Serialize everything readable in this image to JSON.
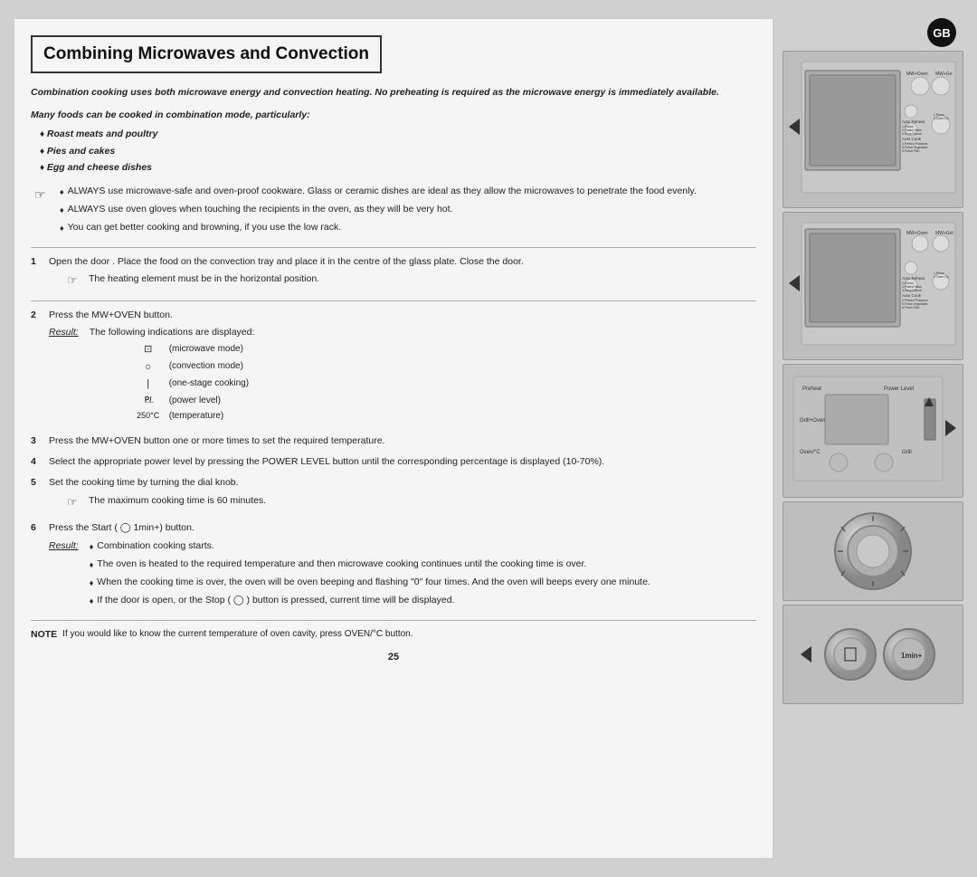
{
  "page": {
    "title": "Combining Microwaves and Convection",
    "page_number": "25",
    "gb_label": "GB"
  },
  "header": {
    "title": "Combining Microwaves and Convection"
  },
  "intro": {
    "text": "Combination cooking uses both microwave energy and convection heating. No preheating is required as the microwave energy is immediately available."
  },
  "foods_heading": "Many foods can be cooked in combination mode, particularly:",
  "food_bullets": [
    "Roast meats and poultry",
    "Pies and cakes",
    "Egg and cheese dishes"
  ],
  "notes": [
    "ALWAYS use microwave-safe and oven-proof cookware. Glass or ceramic dishes are ideal as they allow the microwaves to penetrate the food evenly.",
    "ALWAYS use oven gloves when touching the recipients in the oven, as they will be very hot.",
    "You can get better cooking and browning, if you use the low rack."
  ],
  "steps": [
    {
      "num": "1",
      "text": "Open the door . Place the food on the convection tray and place it in the centre of the glass plate. Close the door.",
      "note": "The heating element must be in the horizontal position."
    },
    {
      "num": "2",
      "text": "Press the MW+OVEN button.",
      "result_label": "Result:",
      "result_intro": "The following indications are displayed:",
      "result_items": [
        {
          "icon": "⊡",
          "text": "(microwave mode)"
        },
        {
          "icon": "☼",
          "text": "(convection mode)"
        },
        {
          "icon": "|",
          "text": "(one-stage cooking)"
        },
        {
          "icon": "P",
          "text": "(power level)"
        },
        {
          "icon": "250°C",
          "text": "(temperature)"
        }
      ]
    },
    {
      "num": "3",
      "text": "Press the MW+OVEN button one or more times to set the required temperature."
    },
    {
      "num": "4",
      "text": "Select the appropriate power level by pressing the POWER LEVEL button until the corresponding percentage is displayed (10-70%)."
    },
    {
      "num": "5",
      "text": "Set the cooking time by turning the dial knob.",
      "note": "The maximum cooking time is 60 minutes."
    },
    {
      "num": "6",
      "text": "Press the Start ( ◯ 1min+) button.",
      "result_label": "Result:",
      "result_bullets": [
        "Combination cooking starts.",
        "The oven is heated to the required temperature and then microwave cooking continues until the cooking time is over.",
        "When the cooking time is over, the oven will be oven beeping and flashing \"0\" four times. And the oven will beeps every one minute.",
        "If the door is open, or the Stop ( ◯ ) button is pressed, current time will be displayed."
      ]
    }
  ],
  "note_footer": {
    "label": "NOTE",
    "text": "If you would like to know the current temperature of oven cavity, press OVEN/°C button."
  },
  "icons": {
    "microwave": "⊡",
    "convection": "☼",
    "one_stage": "|",
    "power": "P",
    "note_symbol": "☞",
    "diamond": "♦"
  }
}
